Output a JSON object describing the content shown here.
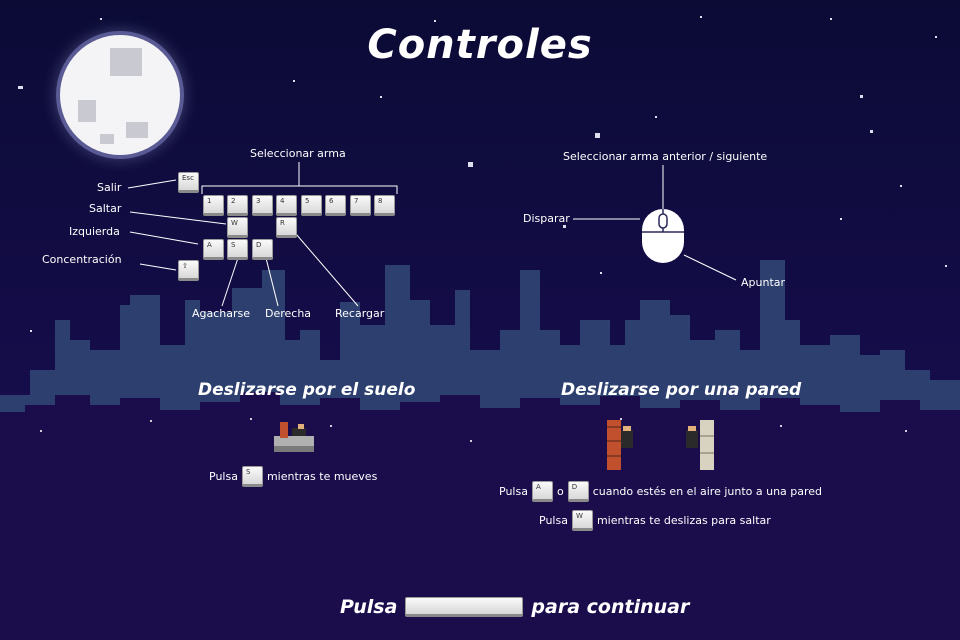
{
  "title": "Controles",
  "labels": {
    "select_weapon": "Seleccionar arma",
    "exit": "Salir",
    "jump": "Saltar",
    "left": "Izquierda",
    "focus": "Concentración",
    "crouch": "Agacharse",
    "right": "Derecha",
    "reload": "Recargar",
    "prev_next_weapon": "Seleccionar arma anterior / siguiente",
    "shoot": "Disparar",
    "aim": "Apuntar"
  },
  "keys": {
    "esc": "Esc",
    "k1": "1",
    "k2": "2",
    "k3": "3",
    "k4": "4",
    "k5": "5",
    "k6": "6",
    "k7": "7",
    "k8": "8",
    "w": "W",
    "r": "R",
    "a": "A",
    "s": "S",
    "d": "D",
    "shift": "⇧"
  },
  "floor_slide": {
    "heading": "Deslizarse por el suelo",
    "press": "Pulsa",
    "key": "S",
    "while_moving": "mientras te mueves"
  },
  "wall_slide": {
    "heading": "Deslizarse por una pared",
    "line1_press": "Pulsa",
    "line1_key_a": "A",
    "line1_or": "o",
    "line1_key_d": "D",
    "line1_rest": "cuando estés en el aire junto a una pared",
    "line2_press": "Pulsa",
    "line2_key": "W",
    "line2_rest": "mientras te deslizas para saltar"
  },
  "footer": {
    "press": "Pulsa",
    "continue": "para continuar"
  },
  "colors": {
    "sky_top": "#0c0c38",
    "sky_bottom": "#1b0d55",
    "city_back": "#2b3d6b",
    "city_front": "#1a0c4a",
    "moon": "#f4f4f6"
  }
}
